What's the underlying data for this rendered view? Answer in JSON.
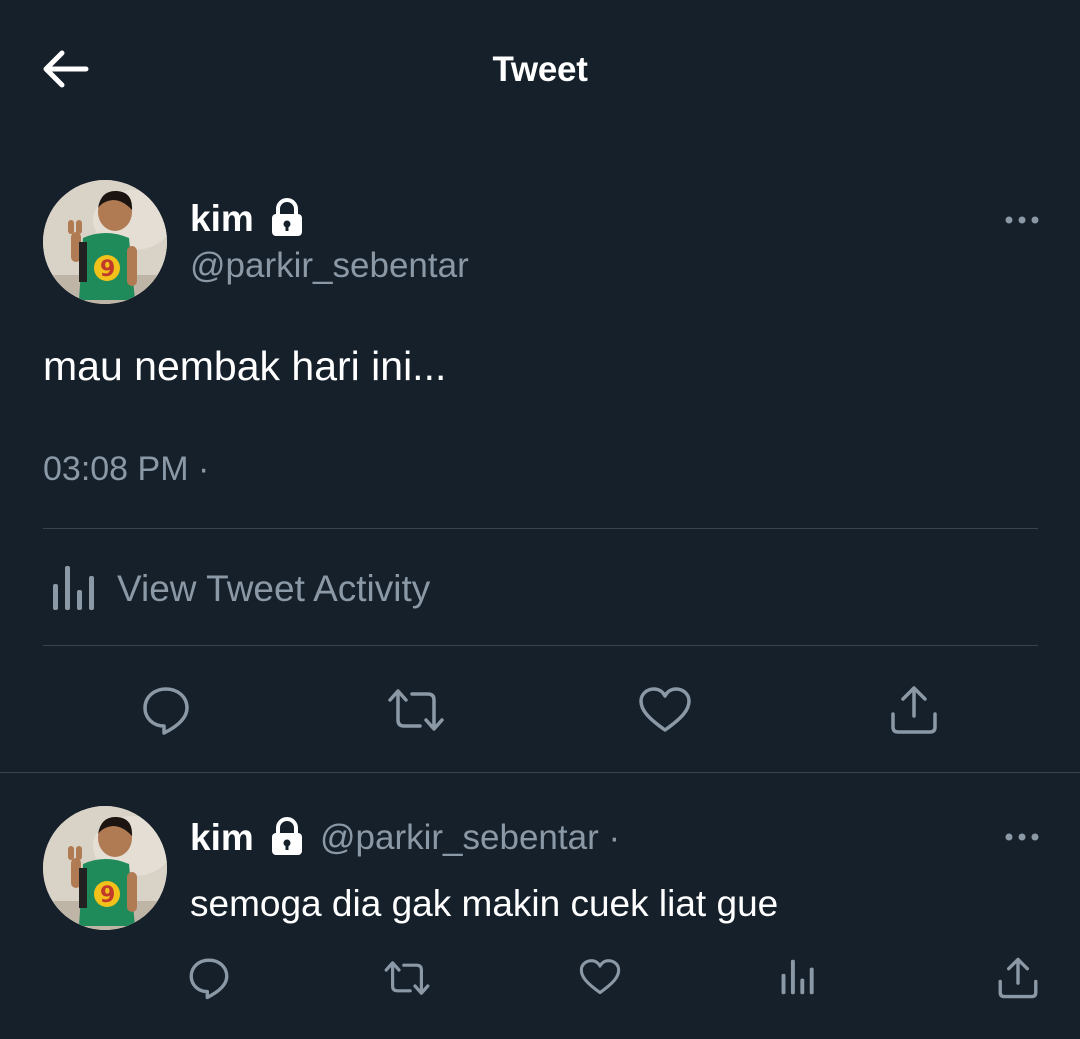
{
  "header": {
    "title": "Tweet"
  },
  "main_tweet": {
    "name": "kim",
    "handle": "@parkir_sebentar",
    "text": "mau nembak hari ini...",
    "timestamp": "03:08 PM ·",
    "activity_label": "View Tweet Activity"
  },
  "reply": {
    "name": "kim",
    "handle": "@parkir_sebentar ·",
    "text": "semoga dia gak makin cuek liat gue"
  },
  "colors": {
    "background": "#15202b",
    "secondary_text": "#8b98a5",
    "divider": "#38444d"
  },
  "icons": {
    "back": "arrow-left-icon",
    "lock": "lock-icon",
    "more": "more-horizontal-icon",
    "reply": "speech-bubble-icon",
    "retweet": "retweet-icon",
    "like": "heart-icon",
    "share": "share-icon",
    "activity": "bar-chart-icon"
  }
}
